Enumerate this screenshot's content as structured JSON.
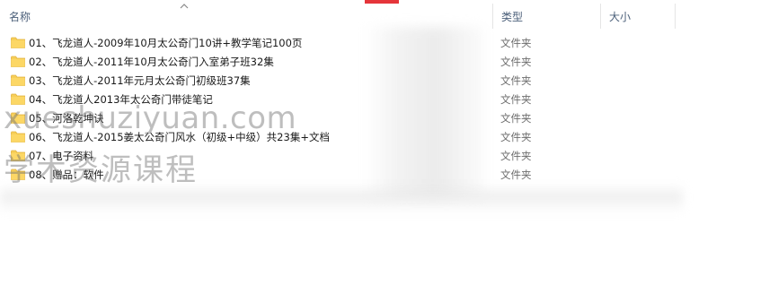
{
  "columns": {
    "name": "名称",
    "type": "类型",
    "size": "大小"
  },
  "icons": {
    "sort": "chevron-up-icon",
    "folder": "folder-icon"
  },
  "colors": {
    "folder_body": "#f7cf58",
    "folder_tab": "#e8b43a",
    "header_text": "#4c607a",
    "type_text": "#6d6d6d",
    "accent_red": "#e5353a"
  },
  "rows": [
    {
      "name": "01、飞龙道人-2009年10月太公奇门10讲+教学笔记100页",
      "type": "文件夹"
    },
    {
      "name": "02、飞龙道人-2011年10月太公奇门入室弟子班32集",
      "type": "文件夹"
    },
    {
      "name": "03、飞龙道人-2011年元月太公奇门初级班37集",
      "type": "文件夹"
    },
    {
      "name": "04、飞龙道人2013年太公奇门带徒笔记",
      "type": "文件夹"
    },
    {
      "name": "05、河洛乾坤诀",
      "type": "文件夹"
    },
    {
      "name": "06、飞龙道人-2015姜太公奇门风水（初级+中级）共23集+文档",
      "type": "文件夹"
    },
    {
      "name": "07、电子资料",
      "type": "文件夹"
    },
    {
      "name": "08、赠品：软件",
      "type": "文件夹"
    }
  ],
  "watermark": {
    "url": "xueshuziyuan.com",
    "text": "学术资源课程"
  }
}
